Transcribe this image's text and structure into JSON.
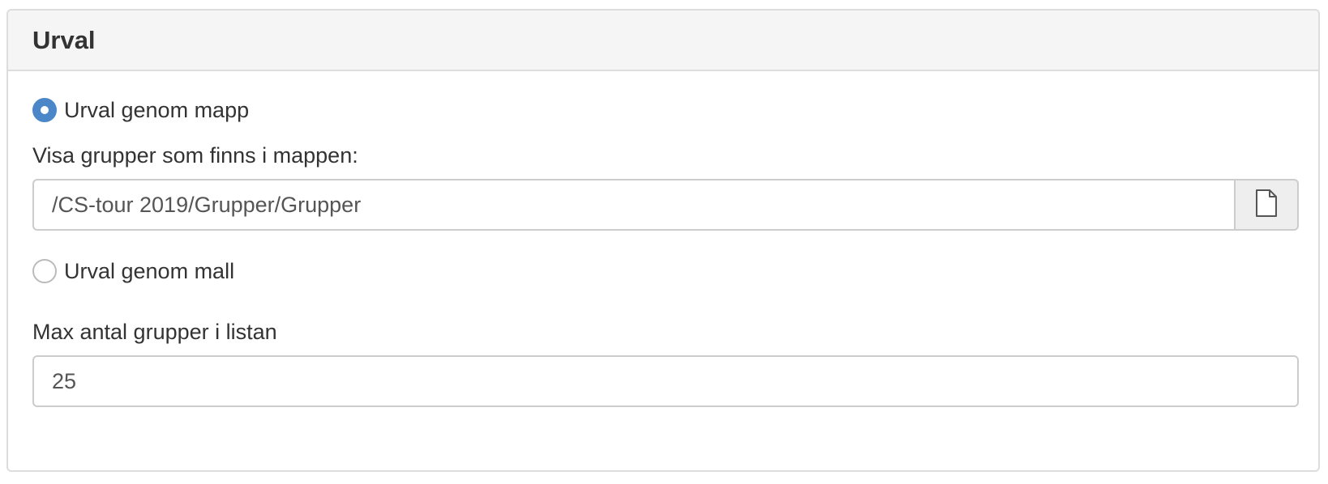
{
  "panel": {
    "title": "Urval"
  },
  "folder_option": {
    "label": "Urval genom mapp",
    "selected": true
  },
  "folder_field": {
    "label": "Visa grupper som finns i mappen:",
    "value": "/CS-tour 2019/Grupper/Grupper",
    "browse_icon": "file-icon"
  },
  "template_option": {
    "label": "Urval genom mall",
    "selected": false
  },
  "max_field": {
    "label": "Max antal grupper i listan",
    "value": "25"
  },
  "colors": {
    "accent": "#4a86c8",
    "heading_bg": "#f5f5f5",
    "border": "#dddddd"
  }
}
